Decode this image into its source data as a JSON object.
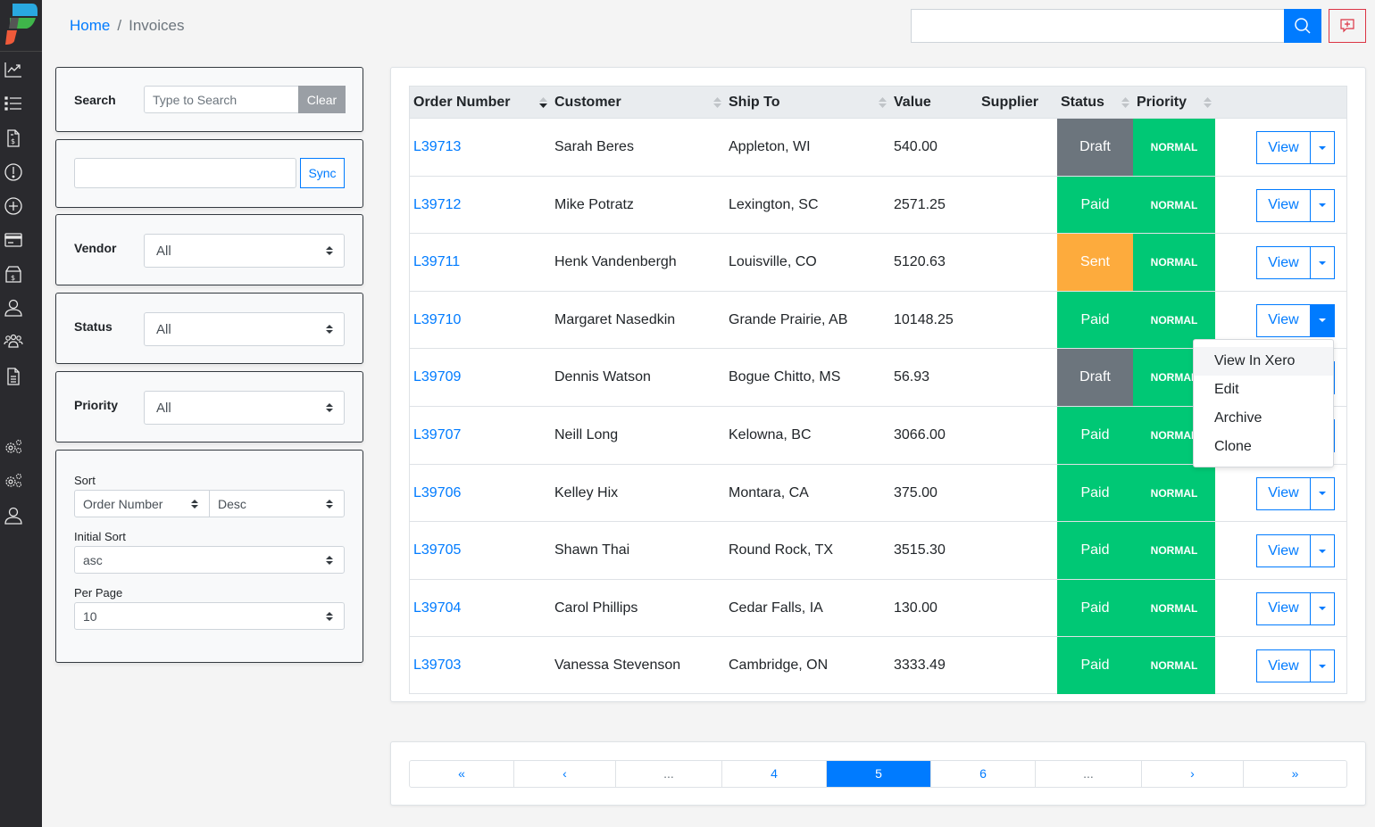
{
  "breadcrumb": {
    "home": "Home",
    "separator": "/",
    "current": "Invoices"
  },
  "topbar": {
    "search_value": "",
    "search_icon": "search-icon",
    "feedback_icon": "message-plus-icon"
  },
  "sidebar": {
    "items": [
      {
        "name": "analytics",
        "icon": "chart-line-icon"
      },
      {
        "name": "list",
        "icon": "list-icon"
      },
      {
        "name": "invoices",
        "icon": "invoice-dollar-icon"
      },
      {
        "name": "alerts",
        "icon": "exclamation-circle-icon"
      },
      {
        "name": "add",
        "icon": "plus-circle-icon"
      },
      {
        "name": "payments",
        "icon": "credit-card-icon"
      },
      {
        "name": "products",
        "icon": "box-dollar-icon"
      },
      {
        "name": "user",
        "icon": "user-icon"
      },
      {
        "name": "team",
        "icon": "users-icon"
      },
      {
        "name": "documents",
        "icon": "document-icon"
      },
      {
        "name": "settings-1",
        "icon": "gears-icon"
      },
      {
        "name": "settings-2",
        "icon": "gears-icon"
      },
      {
        "name": "account",
        "icon": "user-icon"
      }
    ]
  },
  "filters": {
    "search": {
      "label": "Search",
      "placeholder": "Type to Search",
      "value": "",
      "clear_label": "Clear"
    },
    "sync": {
      "value": "",
      "button_label": "Sync"
    },
    "vendor": {
      "label": "Vendor",
      "value": "All"
    },
    "status": {
      "label": "Status",
      "value": "All"
    },
    "priority": {
      "label": "Priority",
      "value": "All"
    },
    "sort": {
      "label": "Sort",
      "field": "Order Number",
      "direction": "Desc"
    },
    "initial_sort": {
      "label": "Initial Sort",
      "value": "asc"
    },
    "per_page": {
      "label": "Per Page",
      "value": "10"
    }
  },
  "table": {
    "columns": [
      "Order Number",
      "Customer",
      "Ship To",
      "Value",
      "Supplier",
      "Status",
      "Priority"
    ],
    "view_label": "View",
    "rows": [
      {
        "order": "L39713",
        "customer": "Sarah Beres",
        "ship_to": "Appleton, WI",
        "value": "540.00",
        "supplier": "",
        "status": "Draft",
        "priority": "NORMAL"
      },
      {
        "order": "L39712",
        "customer": "Mike Potratz",
        "ship_to": "Lexington, SC",
        "value": "2571.25",
        "supplier": "",
        "status": "Paid",
        "priority": "NORMAL"
      },
      {
        "order": "L39711",
        "customer": "Henk Vandenbergh",
        "ship_to": "Louisville, CO",
        "value": "5120.63",
        "supplier": "",
        "status": "Sent",
        "priority": "NORMAL"
      },
      {
        "order": "L39710",
        "customer": "Margaret Nasedkin",
        "ship_to": "Grande Prairie, AB",
        "value": "10148.25",
        "supplier": "",
        "status": "Paid",
        "priority": "NORMAL"
      },
      {
        "order": "L39709",
        "customer": "Dennis Watson",
        "ship_to": "Bogue Chitto, MS",
        "value": "56.93",
        "supplier": "",
        "status": "Draft",
        "priority": "NORMAL"
      },
      {
        "order": "L39707",
        "customer": "Neill Long",
        "ship_to": "Kelowna, BC",
        "value": "3066.00",
        "supplier": "",
        "status": "Paid",
        "priority": "NORMAL"
      },
      {
        "order": "L39706",
        "customer": "Kelley Hix",
        "ship_to": "Montara, CA",
        "value": "375.00",
        "supplier": "",
        "status": "Paid",
        "priority": "NORMAL"
      },
      {
        "order": "L39705",
        "customer": "Shawn Thai",
        "ship_to": "Round Rock, TX",
        "value": "3515.30",
        "supplier": "",
        "status": "Paid",
        "priority": "NORMAL"
      },
      {
        "order": "L39704",
        "customer": "Carol Phillips",
        "ship_to": "Cedar Falls, IA",
        "value": "130.00",
        "supplier": "",
        "status": "Paid",
        "priority": "NORMAL"
      },
      {
        "order": "L39703",
        "customer": "Vanessa Stevenson",
        "ship_to": "Cambridge, ON",
        "value": "3333.49",
        "supplier": "",
        "status": "Paid",
        "priority": "NORMAL"
      }
    ]
  },
  "status_colors": {
    "Draft": "#6c757d",
    "Paid": "#00c875",
    "Sent": "#fdab3d"
  },
  "priority_color": "#00c875",
  "dropdown_menu": {
    "open_for_row": "L39710",
    "items": [
      "View In Xero",
      "Edit",
      "Archive",
      "Clone"
    ],
    "highlighted": "View In Xero"
  },
  "pagination": {
    "items": [
      "«",
      "‹",
      "...",
      "4",
      "5",
      "6",
      "...",
      "›",
      "»"
    ],
    "current": "5"
  }
}
